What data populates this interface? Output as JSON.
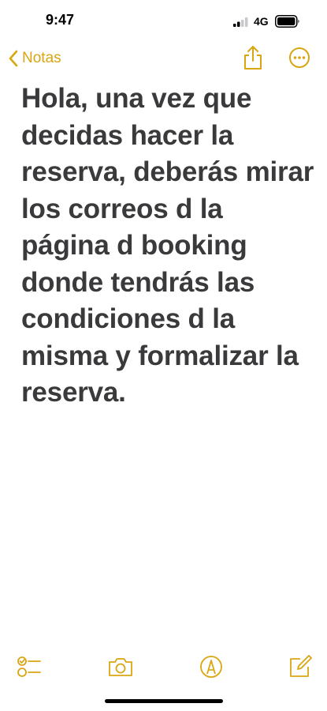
{
  "status": {
    "time": "9:47",
    "network": "4G"
  },
  "nav": {
    "back_label": "Notas"
  },
  "note": {
    "text": "Hola, una vez que decidas hacer la reserva, deberás mirar los correos d la página d booking donde tendrás las condiciones d la misma y formalizar la reserva."
  },
  "icons": {
    "back": "chevron-left-icon",
    "share": "share-icon",
    "more": "ellipsis-circle-icon",
    "checklist": "checklist-icon",
    "camera": "camera-icon",
    "markup": "markup-pen-icon",
    "compose": "compose-icon"
  },
  "colors": {
    "accent": "#d9a612",
    "text": "#3a3a3c"
  }
}
